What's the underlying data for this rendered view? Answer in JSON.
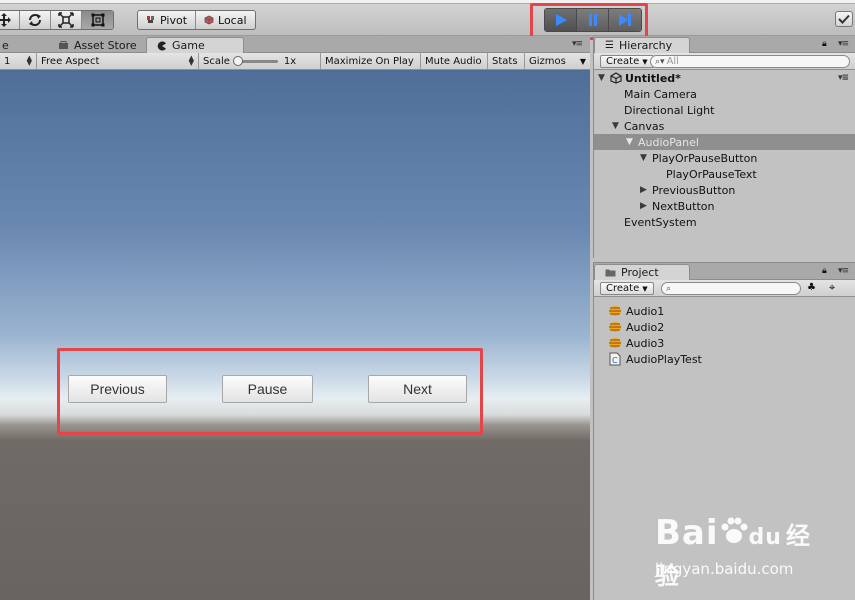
{
  "toolbar": {
    "pivot_label": "Pivot",
    "local_label": "Local",
    "tools": [
      "move-tool",
      "rotate-tool",
      "scale-tool",
      "rect-tool"
    ]
  },
  "game_panel": {
    "tabs": [
      {
        "label": "e"
      },
      {
        "label": "Asset Store"
      },
      {
        "label": "Game"
      }
    ],
    "bar": {
      "display_value": "1",
      "aspect": "Free Aspect",
      "scale_label": "Scale",
      "scale_value": "1x",
      "maximize": "Maximize On Play",
      "mute": "Mute Audio",
      "stats": "Stats",
      "gizmos": "Gizmos"
    },
    "buttons": {
      "previous": "Previous",
      "pause": "Pause",
      "next": "Next"
    }
  },
  "hierarchy": {
    "tab_label": "Hierarchy",
    "create_label": "Create",
    "search_placeholder": "All",
    "scene_name": "Untitled*",
    "items": [
      {
        "label": "Main Camera"
      },
      {
        "label": "Directional Light"
      },
      {
        "label": "Canvas"
      },
      {
        "label": "AudioPanel"
      },
      {
        "label": "PlayOrPauseButton"
      },
      {
        "label": "PlayOrPauseText"
      },
      {
        "label": "PreviousButton"
      },
      {
        "label": "NextButton"
      },
      {
        "label": "EventSystem"
      }
    ]
  },
  "project": {
    "tab_label": "Project",
    "create_label": "Create",
    "assets": [
      {
        "label": "Audio1",
        "icon": "audio-clip-icon"
      },
      {
        "label": "Audio2",
        "icon": "audio-clip-icon"
      },
      {
        "label": "Audio3",
        "icon": "audio-clip-icon"
      },
      {
        "label": "AudioPlayTest",
        "icon": "csharp-script-icon"
      }
    ]
  },
  "watermark": {
    "logo": "Bai",
    "logo_suffix": "du",
    "logo_cn": "经验",
    "url": "jingyan.baidu.com"
  },
  "colors": {
    "highlight": "#e2464a",
    "play_blue": "#3a8bff",
    "selection": "#8f8f8f"
  }
}
